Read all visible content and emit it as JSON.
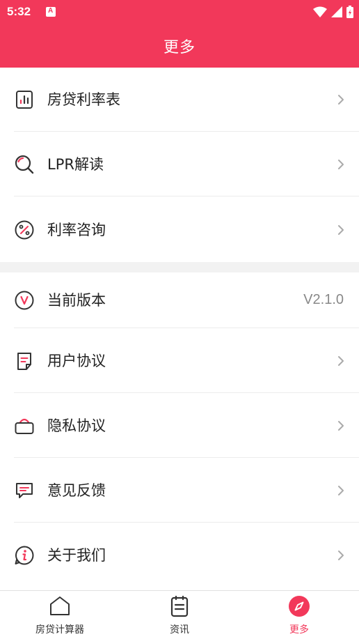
{
  "status_bar": {
    "time": "5:32"
  },
  "header": {
    "title": "更多"
  },
  "section1": [
    {
      "label": "房贷利率表"
    },
    {
      "label": "LPR解读"
    },
    {
      "label": "利率咨询"
    }
  ],
  "section2": [
    {
      "label": "当前版本",
      "value": "V2.1.0"
    },
    {
      "label": "用户协议"
    },
    {
      "label": "隐私协议"
    },
    {
      "label": "意见反馈"
    },
    {
      "label": "关于我们"
    }
  ],
  "tabs": [
    {
      "label": "房贷计算器",
      "active": false
    },
    {
      "label": "资讯",
      "active": false
    },
    {
      "label": "更多",
      "active": true
    }
  ],
  "colors": {
    "accent": "#f2385a",
    "icon_stroke": "#333333",
    "divider": "#ececec"
  }
}
